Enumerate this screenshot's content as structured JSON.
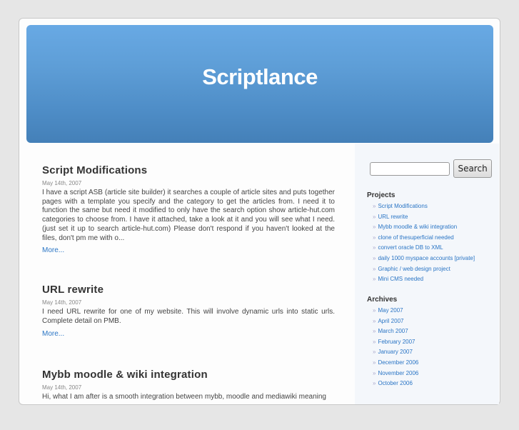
{
  "site": {
    "title": "Scriptlance"
  },
  "posts": [
    {
      "title": "Script Modifications",
      "date": "May 14th, 2007",
      "excerpt": "I have a script ASB (article site builder) it searches a couple of article sites and puts together pages with a template you specify and the category to get the articles from. I need it to function the same but need it modified to only have the search option show article-hut.com categories to choose from. I have it attached, take a look at it and you will see what I need. (just set it up to search article-hut.com) Please don't respond if you haven't looked at the files, don't pm me with o...",
      "more": "More..."
    },
    {
      "title": "URL rewrite",
      "date": "May 14th, 2007",
      "excerpt": "I need URL rewrite for one of my website. This will involve dynamic urls into static urls. Complete detail on PMB.",
      "more": "More..."
    },
    {
      "title": "Mybb moodle & wiki integration",
      "date": "May 14th, 2007",
      "excerpt": "Hi, what I am after is a smooth integration between mybb, moodle and mediawiki meaning",
      "more": ""
    }
  ],
  "sidebar": {
    "search": {
      "value": "",
      "button_label": "Search"
    },
    "projects": {
      "heading": "Projects",
      "items": [
        "Script Modifications",
        "URL rewrite",
        "Mybb moodle & wiki integration",
        "clone of thesuperficial needed",
        "convert oracle DB to XML",
        "daily 1000 myspace accounts [private]",
        "Graphic / web design project",
        "Mini CMS needed"
      ]
    },
    "archives": {
      "heading": "Archives",
      "items": [
        "May 2007",
        "April 2007",
        "March 2007",
        "February 2007",
        "January 2007",
        "December 2006",
        "November 2006",
        "October 2006"
      ]
    },
    "bullet": "»"
  },
  "colors": {
    "accent": "#2a75c5",
    "header_top": "#68a9e4",
    "header_bottom": "#4480b8"
  }
}
